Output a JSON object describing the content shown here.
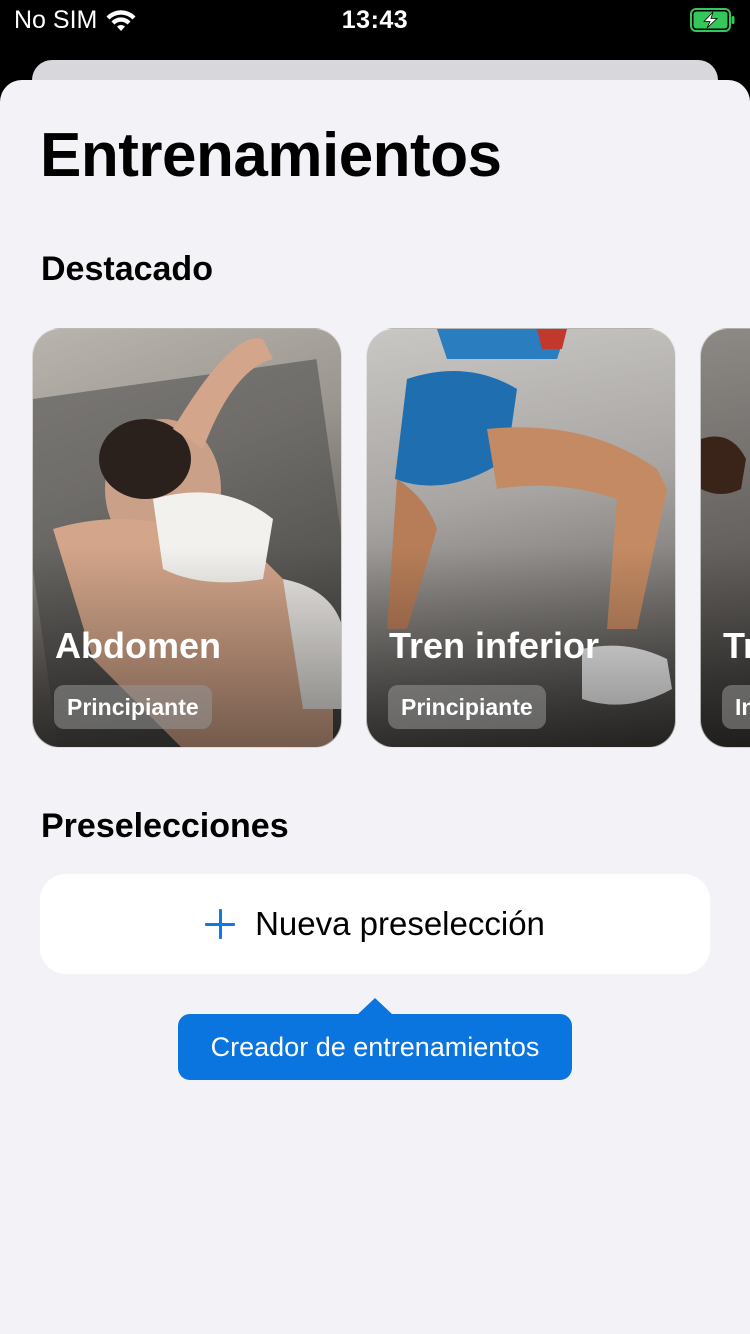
{
  "status_bar": {
    "carrier": "No SIM",
    "time": "13:43",
    "wifi_icon": "wifi-icon",
    "battery_icon": "battery-charging-icon",
    "battery_color": "#34c759"
  },
  "page": {
    "title": "Entrenamientos"
  },
  "featured": {
    "section_title": "Destacado",
    "cards": [
      {
        "title": "Abdomen",
        "level": "Principiante"
      },
      {
        "title": "Tren inferior",
        "level": "Principiante"
      },
      {
        "title": "Tr",
        "level": "In"
      }
    ]
  },
  "presets": {
    "section_title": "Preselecciones",
    "new_button_label": "Nueva preselección",
    "new_button_icon": "plus-icon",
    "accent_color": "#0a7be6"
  },
  "tooltip": {
    "label": "Creador de entrenamientos",
    "color": "#0a74df"
  }
}
